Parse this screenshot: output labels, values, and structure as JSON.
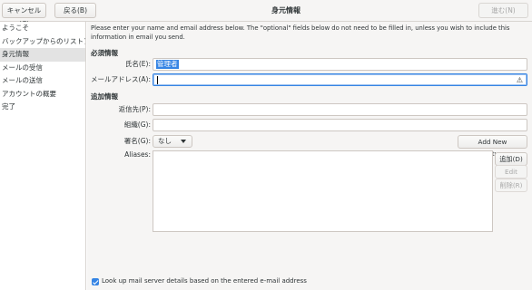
{
  "header": {
    "cancel_label": "キャンセル(C)",
    "back_label": "戻る(B)",
    "title": "身元情報",
    "next_label": "進む(N)"
  },
  "sidebar": {
    "items": [
      {
        "label": "ようこそ",
        "active": false
      },
      {
        "label": "バックアップからのリストア",
        "active": false
      },
      {
        "label": "身元情報",
        "active": true
      },
      {
        "label": "メールの受信",
        "active": false
      },
      {
        "label": "メールの送信",
        "active": false
      },
      {
        "label": "アカウントの概要",
        "active": false
      },
      {
        "label": "完了",
        "active": false
      }
    ]
  },
  "main": {
    "intro": "Please enter your name and email address below. The \"optional\" fields below do not need to be filled in, unless you wish to include this information in email you send.",
    "required_heading": "必須情報",
    "name_label": "氏名(E):",
    "name_value": "管理者",
    "email_label": "メールアドレス(A):",
    "email_value": "",
    "email_warning_icon": "warning-icon",
    "optional_heading": "追加情報",
    "reply_to_label": "返信先(P):",
    "reply_to_value": "",
    "org_label": "組織(G):",
    "org_value": "",
    "signature_label": "署名(G):",
    "signature_selected": "なし",
    "add_signature_label": "Add New Signature...",
    "aliases_label": "Aliases:",
    "alias_add_label": "追加(D)",
    "alias_edit_label": "Edit",
    "alias_remove_label": "削除(R)",
    "lookup_label": "Look up mail server details based on the entered e-mail address",
    "lookup_checked": true
  },
  "colors": {
    "accent": "#3584e4",
    "window_bg": "#f6f5f4",
    "sidebar_active": "#e3e3e3"
  }
}
